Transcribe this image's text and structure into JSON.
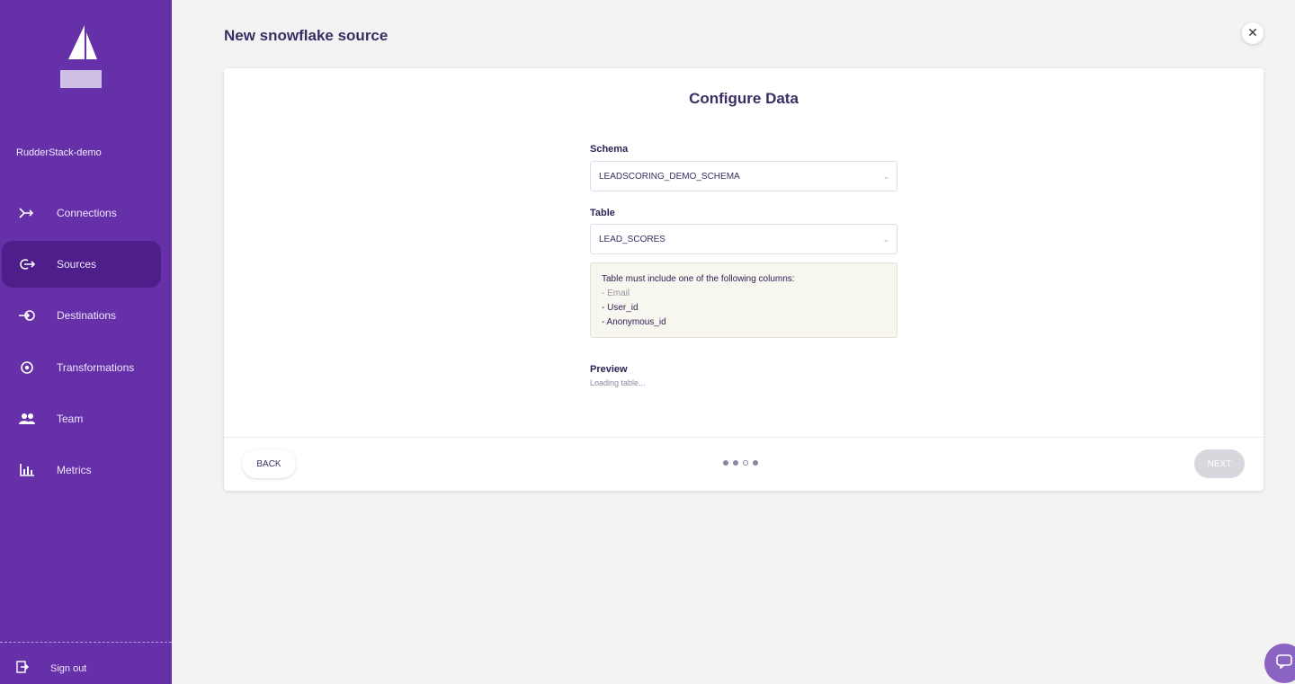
{
  "sidebar": {
    "workspace_name": "RudderStack-demo",
    "nav": [
      {
        "label": "Connections",
        "icon": "connections-icon",
        "active": false
      },
      {
        "label": "Sources",
        "icon": "sources-icon",
        "active": true
      },
      {
        "label": "Destinations",
        "icon": "destinations-icon",
        "active": false
      },
      {
        "label": "Transformations",
        "icon": "transformations-icon",
        "active": false
      },
      {
        "label": "Team",
        "icon": "team-icon",
        "active": false
      },
      {
        "label": "Metrics",
        "icon": "metrics-icon",
        "active": false
      }
    ],
    "sign_out_label": "Sign out"
  },
  "page": {
    "title": "New snowflake source"
  },
  "card": {
    "title": "Configure Data",
    "schema": {
      "label": "Schema",
      "value": "LEADSCORING_DEMO_SCHEMA"
    },
    "table": {
      "label": "Table",
      "value": "LEAD_SCORES"
    },
    "notice": {
      "intro": "Table must include one of the following columns:",
      "columns": [
        "- Email",
        "- User_id",
        "- Anonymous_id"
      ]
    },
    "preview": {
      "label": "Preview",
      "status": "Loading table..."
    },
    "back_label": "BACK",
    "next_label": "NEXT",
    "steps_total": 4,
    "steps_current": 3
  },
  "colors": {
    "sidebar_bg": "#6631a8",
    "sidebar_active": "#4e1f8a",
    "page_bg": "#f3f3f3"
  }
}
